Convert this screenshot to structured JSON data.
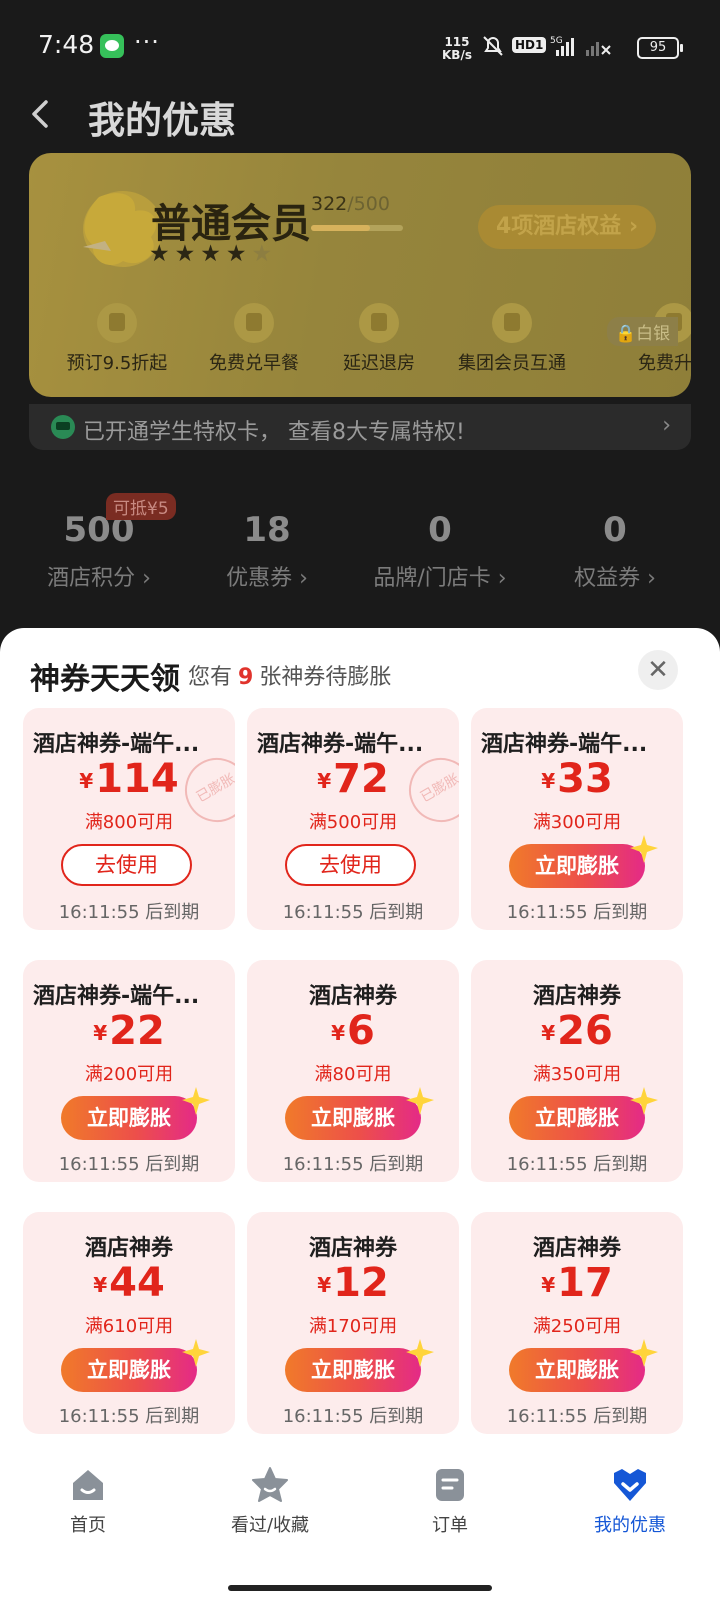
{
  "status_bar": {
    "time": "7:48",
    "net_speed_value": "115",
    "net_speed_unit": "KB/s",
    "hd_label": "HD1",
    "network": "5G",
    "battery": "95",
    "more": "···"
  },
  "header": {
    "title": "我的优惠"
  },
  "member_card": {
    "level": "普通会员",
    "points_current": "322",
    "points_target": "/500",
    "progress": 0.644,
    "stars_total": 5,
    "stars_filled": 4,
    "star_on": "★★★★",
    "star_off": "★",
    "rights_button": "4项酒店权益",
    "rights_arrow": "›",
    "silver_lock": "🔒白银",
    "perks": [
      {
        "label": "预订9.5折起",
        "icon": "discount-icon"
      },
      {
        "label": "免费兑早餐",
        "icon": "breakfast-icon"
      },
      {
        "label": "延迟退房",
        "icon": "late-checkout-icon"
      },
      {
        "label": "集团会员互通",
        "icon": "shield-icon"
      },
      {
        "label": "免费升房",
        "icon": "upgrade-icon"
      }
    ]
  },
  "student_bar": {
    "text": "已开通学生特权卡， 查看8大专属特权!",
    "arrow": "›"
  },
  "stats": [
    {
      "value": "500",
      "label": "酒店积分 ›"
    },
    {
      "value": "18",
      "label": "优惠券 ›"
    },
    {
      "value": "0",
      "label": "品牌/门店卡 ›"
    },
    {
      "value": "0",
      "label": "权益券 ›"
    }
  ],
  "deduct_badge": "可抵¥5",
  "sheet": {
    "title": "神券天天领",
    "subtitle_prefix": "您有",
    "subtitle_count": "9",
    "subtitle_suffix": "张神券待膨胀",
    "close": "✕"
  },
  "coupons": [
    {
      "name": "酒店神券-端午...",
      "amount": "114",
      "condition": "满800可用",
      "action": "去使用",
      "expiry": "16:11:55 后到期",
      "stamp": "已膨胀"
    },
    {
      "name": "酒店神券-端午...",
      "amount": "72",
      "condition": "满500可用",
      "action": "去使用",
      "expiry": "16:11:55 后到期",
      "stamp": "已膨胀"
    },
    {
      "name": "酒店神券-端午...",
      "amount": "33",
      "condition": "满300可用",
      "action": "立即膨胀",
      "expiry": "16:11:55 后到期"
    },
    {
      "name": "酒店神券-端午...",
      "amount": "22",
      "condition": "满200可用",
      "action": "立即膨胀",
      "expiry": "16:11:55 后到期"
    },
    {
      "name": "酒店神券",
      "amount": "6",
      "condition": "满80可用",
      "action": "立即膨胀",
      "expiry": "16:11:55 后到期"
    },
    {
      "name": "酒店神券",
      "amount": "26",
      "condition": "满350可用",
      "action": "立即膨胀",
      "expiry": "16:11:55 后到期"
    },
    {
      "name": "酒店神券",
      "amount": "44",
      "condition": "满610可用",
      "action": "立即膨胀",
      "expiry": "16:11:55 后到期"
    },
    {
      "name": "酒店神券",
      "amount": "12",
      "condition": "满170可用",
      "action": "立即膨胀",
      "expiry": "16:11:55 后到期"
    },
    {
      "name": "酒店神券",
      "amount": "17",
      "condition": "满250可用",
      "action": "立即膨胀",
      "expiry": "16:11:55 后到期"
    }
  ],
  "currency": "¥",
  "tab_bar": [
    {
      "label": "首页",
      "icon": "home-icon"
    },
    {
      "label": "看过/收藏",
      "icon": "star-icon"
    },
    {
      "label": "订单",
      "icon": "order-icon"
    },
    {
      "label": "我的优惠",
      "icon": "coupon-heart-icon",
      "active": true
    }
  ],
  "colors": {
    "accent_red": "#e1251b",
    "active_tab": "#1557d6",
    "coupon_bg": "#fdecec"
  }
}
